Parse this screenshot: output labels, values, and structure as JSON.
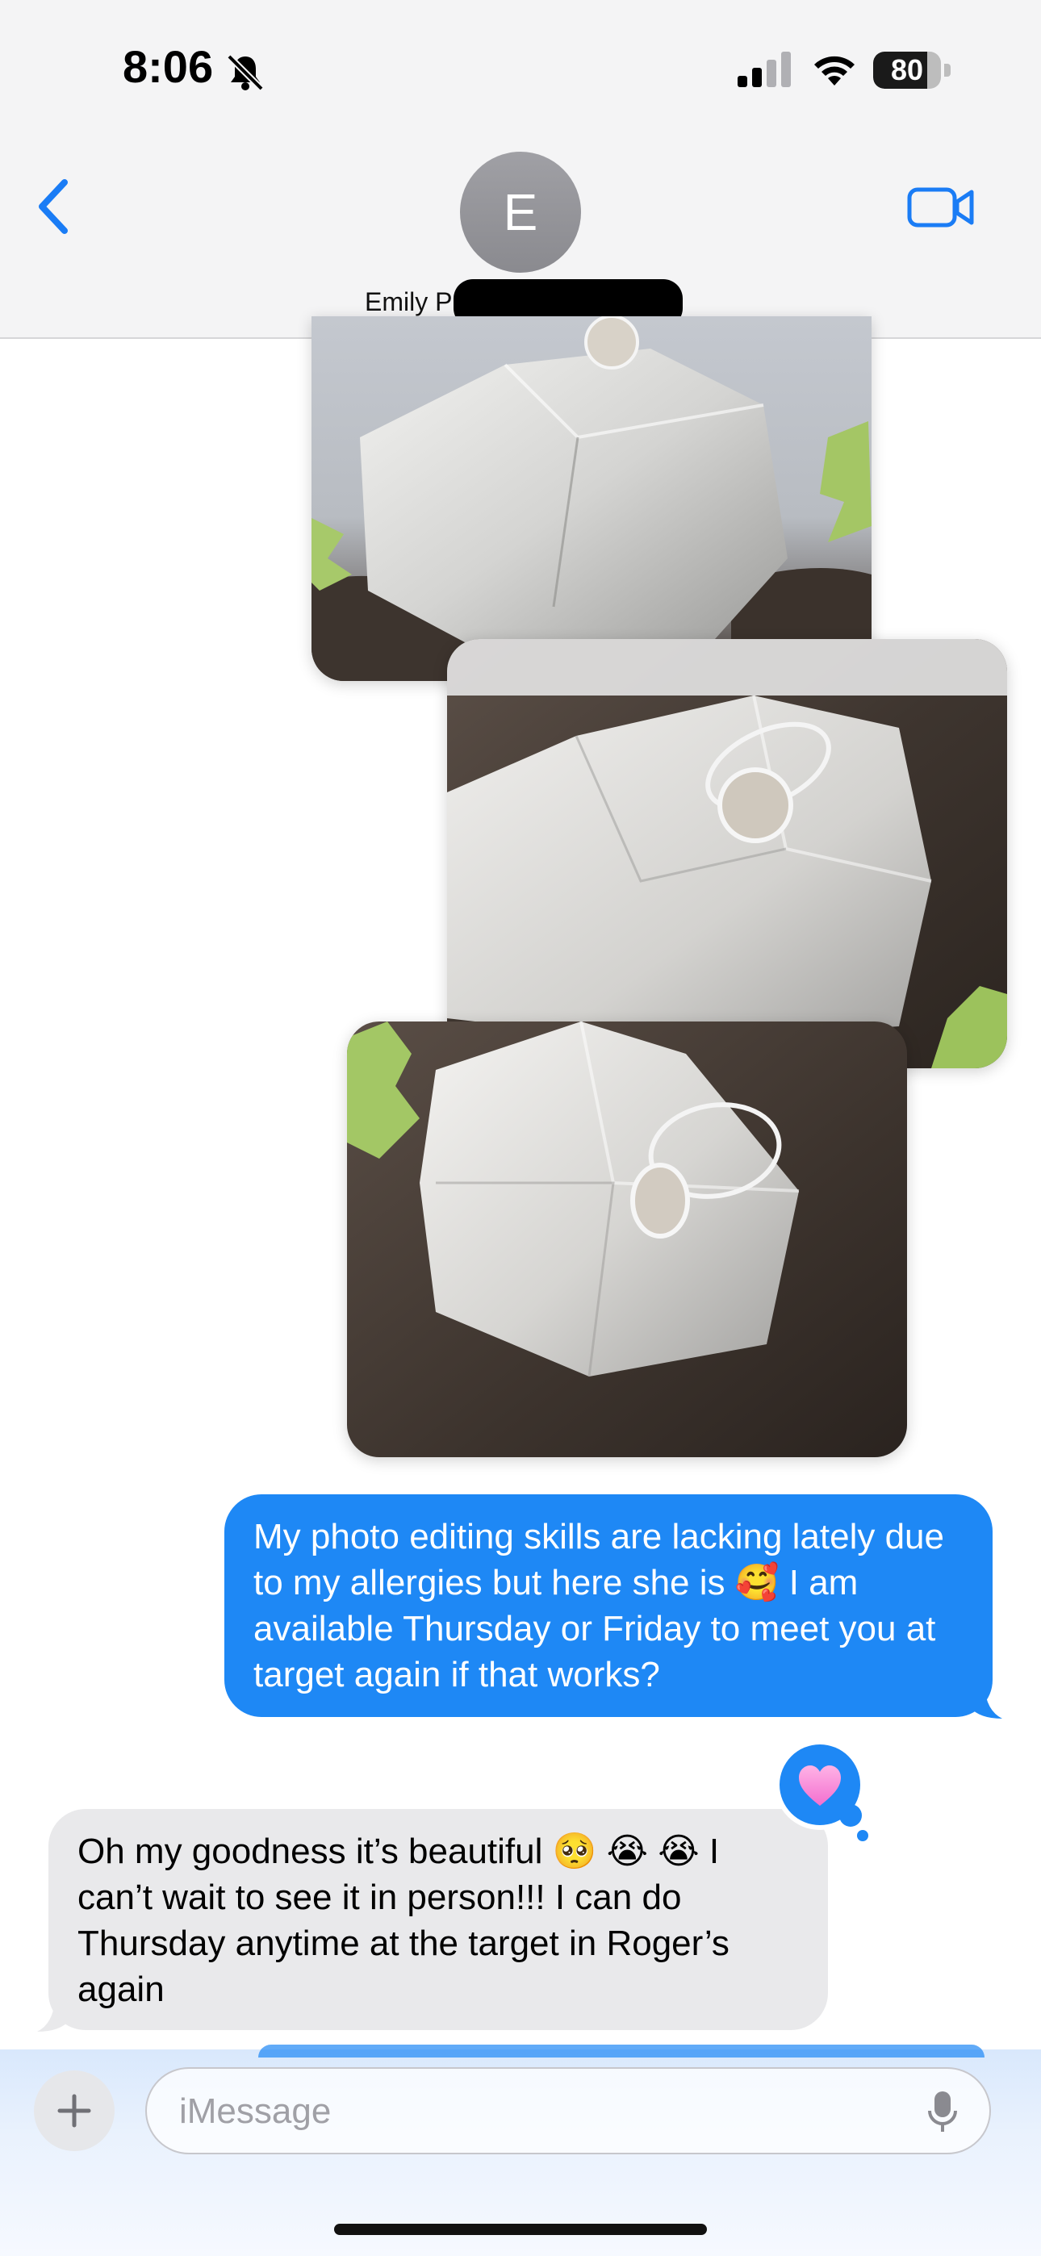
{
  "status_bar": {
    "time": "8:06",
    "battery": "80",
    "battery_level": 0.8,
    "icons": [
      "bell-slash-icon",
      "cellular-signal-icon",
      "wifi-icon",
      "battery-icon"
    ]
  },
  "header": {
    "avatar_initial": "E",
    "contact_name": "Emily P",
    "icons": [
      "chevron-left-icon",
      "video-camera-icon"
    ]
  },
  "photos": [
    {
      "alt": "ring on quartz crystal"
    },
    {
      "alt": "ring on quartz crystal"
    },
    {
      "alt": "ring on quartz crystal"
    }
  ],
  "messages": [
    {
      "direction": "sent",
      "text": "My photo editing skills are lacking lately due to my allergies but here she is 🥰 I am available Thursday or Friday to meet you at target again if that works?"
    },
    {
      "direction": "received",
      "text": "Oh my goodness it’s beautiful 🥺 😭 😭 I can’t wait to see it in person!!!  I can do Thursday anytime at the target in Roger’s again",
      "tapback": "heart"
    }
  ],
  "composer": {
    "placeholder": "iMessage",
    "icons": [
      "plus-icon",
      "microphone-icon"
    ]
  },
  "colors": {
    "accent": "#1e88f5",
    "received_bubble": "#e9e9eb",
    "tapback_heart": "#ff8ad8"
  }
}
